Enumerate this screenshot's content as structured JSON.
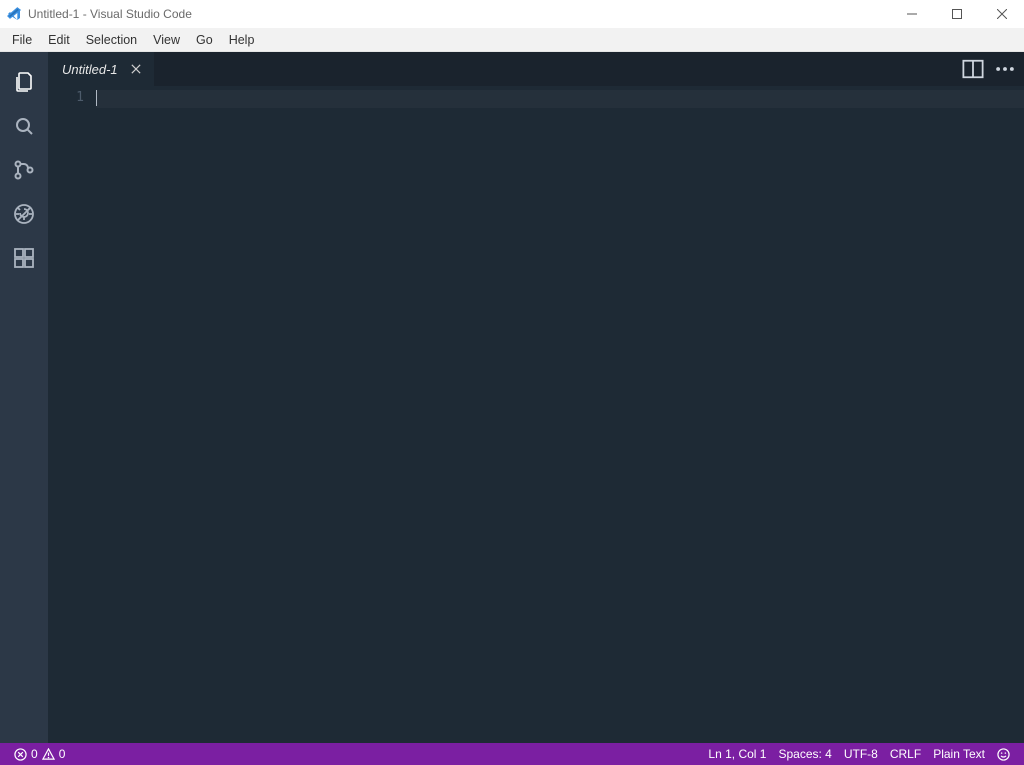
{
  "window": {
    "title": "Untitled-1 - Visual Studio Code"
  },
  "menubar": {
    "items": [
      "File",
      "Edit",
      "Selection",
      "View",
      "Go",
      "Help"
    ]
  },
  "activitybar": {
    "items": [
      {
        "name": "explorer",
        "active": true
      },
      {
        "name": "search",
        "active": false
      },
      {
        "name": "scm",
        "active": false
      },
      {
        "name": "debug",
        "active": false
      },
      {
        "name": "extensions",
        "active": false
      }
    ]
  },
  "tabs": {
    "open": [
      {
        "label": "Untitled-1",
        "dirty": false,
        "active": true
      }
    ]
  },
  "editor": {
    "first_line_number": "1"
  },
  "statusbar": {
    "errors": "0",
    "warnings": "0",
    "cursor": "Ln 1, Col 1",
    "spaces": "Spaces: 4",
    "encoding": "UTF-8",
    "eol": "CRLF",
    "language": "Plain Text"
  },
  "colors": {
    "statusbar_bg": "#7b1fa2",
    "editor_bg": "#1e2a35",
    "activity_bg": "#2c3847"
  }
}
